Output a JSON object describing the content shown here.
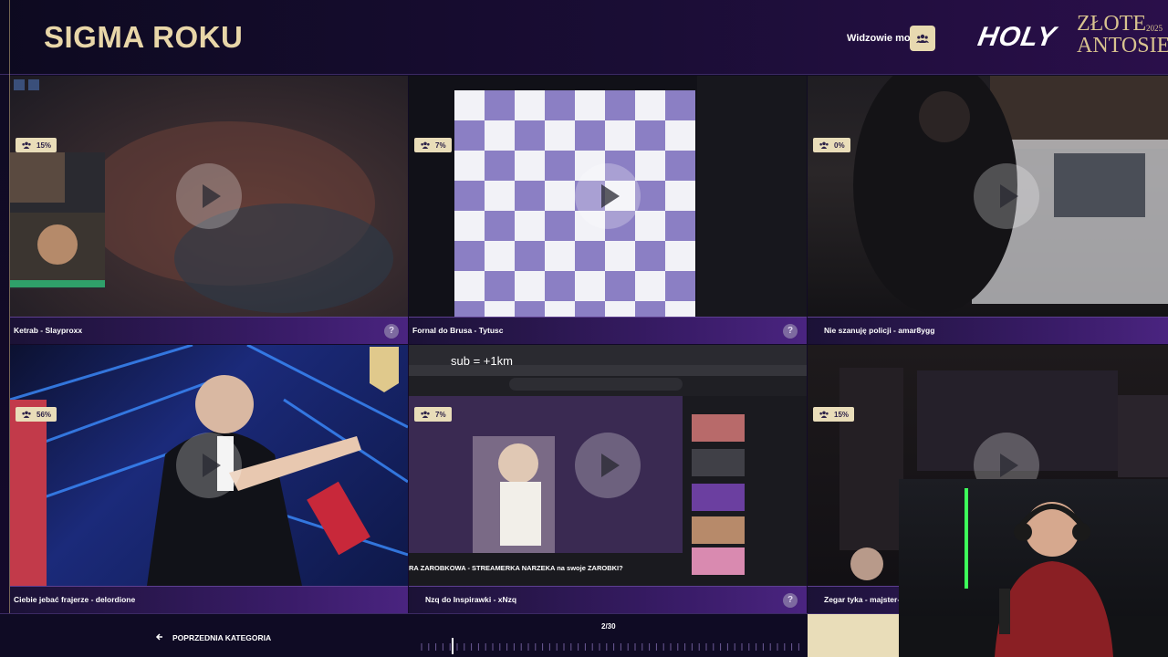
{
  "header": {
    "title": "SIGMA ROKU",
    "viewers_label": "Widzowie mogą",
    "logo_text": "HOLY",
    "brand_text_line1": "ZŁOTE",
    "brand_text_line2": "ANTOSIE",
    "brand_year": "2025"
  },
  "tiles": [
    {
      "caption": "Ketrab - Slayproxx",
      "percent": "15%"
    },
    {
      "caption": "Fornal do Brusa - Tytusc",
      "percent": "7%"
    },
    {
      "caption": "Nie szanuję policji - amar8ygg",
      "percent": "0%"
    },
    {
      "caption": "Ciebie jebać frajerze - delordione",
      "percent": "56%"
    },
    {
      "caption": "Nzq do Inspirawki - xNzq",
      "percent": "7%"
    },
    {
      "caption": "Zegar tyka - majster-sys",
      "percent": "15%"
    }
  ],
  "overlay": {
    "sub_text": "sub = +1km",
    "clip_title": "RA ZAROBKOWA - STREAMERKA NARZEKA na swoje ZAROBKI?"
  },
  "footer": {
    "prev_label": "POPRZEDNIA KATEGORIA",
    "page_indicator": "2/30"
  },
  "icons": {
    "viewers": "group-icon",
    "help": "question-icon",
    "back": "arrow-left-icon",
    "play": "play-icon"
  }
}
